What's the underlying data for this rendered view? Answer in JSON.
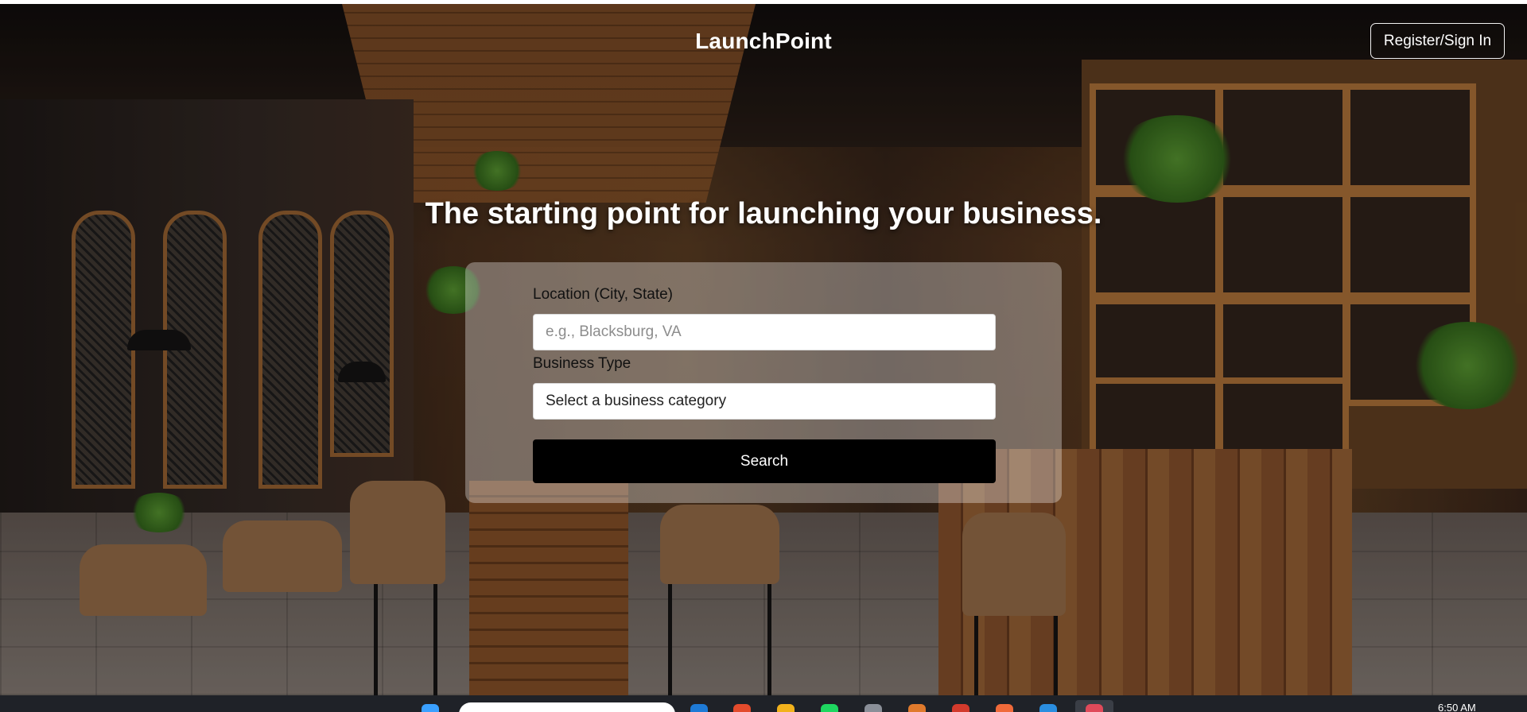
{
  "header": {
    "brand": "LaunchPoint",
    "auth_button": "Register/Sign In"
  },
  "hero": {
    "headline": "The starting point for launching your business."
  },
  "search_form": {
    "location_label": "Location (City, State)",
    "location_placeholder": "e.g., Blacksburg, VA",
    "business_type_label": "Business Type",
    "business_type_selected": "Select a business category",
    "search_button": "Search"
  },
  "taskbar": {
    "clock_time": "6:50 AM",
    "icons": [
      "start-icon",
      "search-box",
      "edge-icon",
      "chrome-icon",
      "folder-icon",
      "spotify-icon",
      "app-icon",
      "app-icon",
      "app-icon",
      "app-icon",
      "app-icon",
      "active-app-icon"
    ]
  },
  "colors": {
    "card_bg": "rgba(255,255,255,0.33)",
    "button_bg": "#000000",
    "text_light": "#ffffff"
  }
}
